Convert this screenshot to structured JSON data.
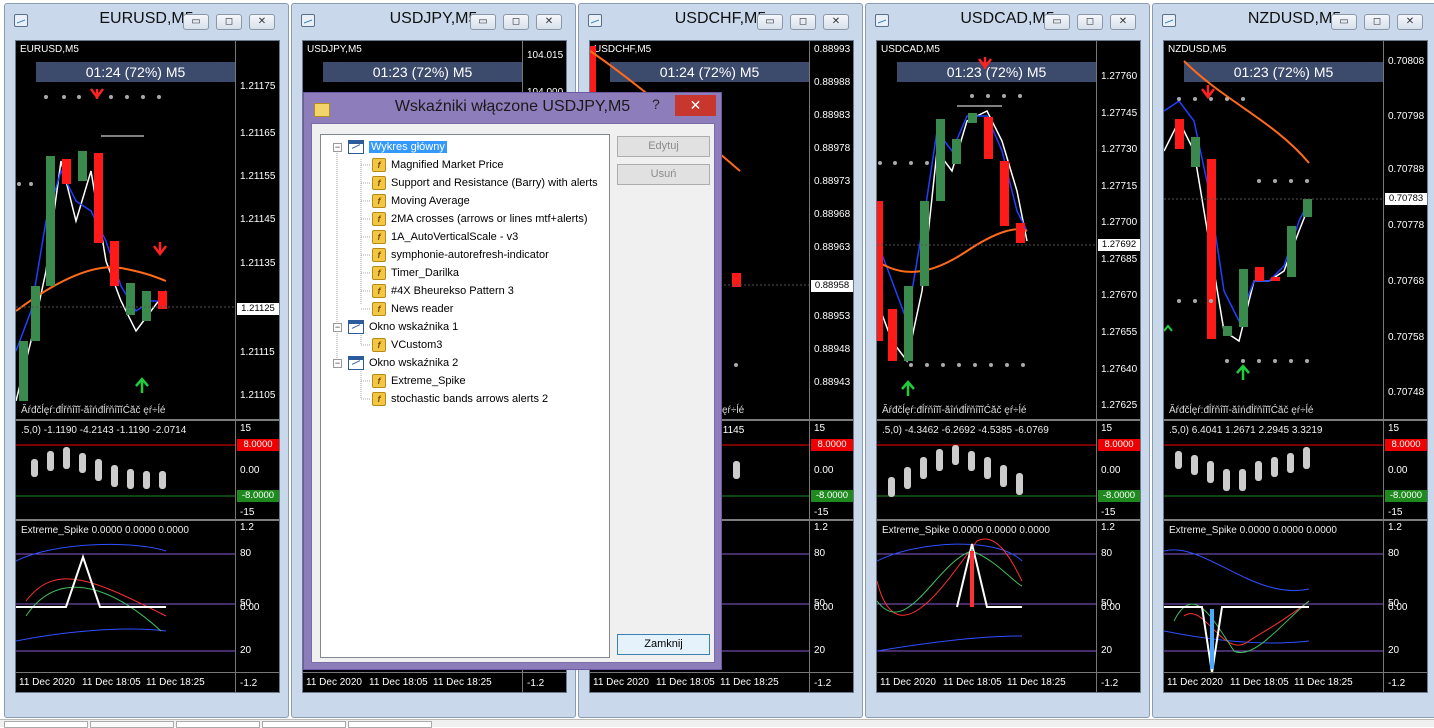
{
  "windows": [
    {
      "id": "eurusd",
      "title": "EURUSD,M5",
      "chart_label": "EURUSD,M5",
      "timer": "01:24 (72%) M5",
      "prices": [
        "1.21175",
        "1.21165",
        "1.21155",
        "1.21145",
        "1.21135",
        "1.21125",
        "1.21115",
        "1.21105"
      ],
      "current_price": "1.21125",
      "gibberish": "Ăŕđčĺęŕ:đĺřňîĭĭ-ăîńđĺřňîĭĭĆăč ęŕ÷ĺé",
      "indicator1_text": ".5,0) -1.1190 -4.2143 -1.1190 -2.0714",
      "indicator1_scale": [
        "15",
        "8.0000",
        "0.00",
        "-8.0000",
        "-15"
      ],
      "indicator2_text": "Extreme_Spike 0.0000 0.0000 0.0000",
      "indicator2_scale": [
        "1.2",
        "80",
        "50",
        "0.00",
        "20",
        "-1.2"
      ],
      "times": [
        "11 Dec 2020",
        "11 Dec 18:05",
        "11 Dec 18:25"
      ]
    },
    {
      "id": "usdjpy",
      "title": "USDJPY,M5",
      "chart_label": "USDJPY,M5",
      "timer": "01:23 (72%) M5",
      "prices": [
        "104.015",
        "104.000"
      ],
      "indicator2_scale": [
        "-1.2"
      ],
      "times": [
        "11 Dec 2020",
        "11 Dec 18:05",
        "11 Dec 18:25"
      ]
    },
    {
      "id": "usdchf",
      "title": "USDCHF,M5",
      "chart_label": "USDCHF,M5",
      "timer": "01:24 (72%) M5",
      "prices": [
        "0.88993",
        "0.88988",
        "0.88983",
        "0.88978",
        "0.88973",
        "0.88968",
        "0.88963",
        "0.88958",
        "0.88953",
        "0.88948",
        "0.88943"
      ],
      "current_price": "0.88958",
      "gibberish": "ęŕ÷ĺé",
      "indicator1_text": ".1145",
      "indicator1_scale": [
        "15",
        "8.0000",
        "0.00",
        "-8.0000",
        "-15"
      ],
      "indicator2_scale": [
        "1.2",
        "80",
        "50",
        "0.00",
        "20",
        "-1.2"
      ],
      "times": [
        "11 Dec 2020",
        "11 Dec 18:05",
        "11 Dec 18:25"
      ]
    },
    {
      "id": "usdcad",
      "title": "USDCAD,M5",
      "chart_label": "USDCAD,M5",
      "timer": "01:23 (72%) M5",
      "prices": [
        "1.27760",
        "1.27745",
        "1.27730",
        "1.27715",
        "1.27700",
        "1.27685",
        "1.27670",
        "1.27655",
        "1.27640",
        "1.27625"
      ],
      "current_price": "1.27692",
      "gibberish": "Ăŕđčĺęŕ:đĺřňîĭĭ-ăîńđĺřňîĭĭĆăč ęŕ÷ĺé",
      "indicator1_text": ".5,0) -4.3462 -6.2692 -4.5385 -6.0769",
      "indicator1_scale": [
        "15",
        "8.0000",
        "0.00",
        "-8.0000",
        "-15"
      ],
      "indicator2_text": "Extreme_Spike 0.0000 0.0000 0.0000",
      "indicator2_scale": [
        "1.2",
        "80",
        "50",
        "0.00",
        "20",
        "-1.2"
      ],
      "times": [
        "11 Dec 2020",
        "11 Dec 18:05",
        "11 Dec 18:25"
      ]
    },
    {
      "id": "nzdusd",
      "title": "NZDUSD,M5",
      "chart_label": "NZDUSD,M5",
      "timer": "01:23 (72%) M5",
      "prices": [
        "0.70808",
        "0.70798",
        "0.70788",
        "0.70778",
        "0.70768",
        "0.70758",
        "0.70748"
      ],
      "current_price": "0.70783",
      "gibberish": "Ăŕđčĺęŕ:đĺřňîĭĭ-ăîńđĺřňîĭĭĆăč ęŕ÷ĺé",
      "indicator1_text": ".5,0) 6.4041 1.2671 2.2945 3.3219",
      "indicator1_scale": [
        "15",
        "8.0000",
        "0.00",
        "-8.0000",
        "-15"
      ],
      "indicator2_text": "Extreme_Spike 0.0000 0.0000 0.0000",
      "indicator2_scale": [
        "1.2",
        "80",
        "50",
        "0.00",
        "20",
        "-1.2"
      ],
      "times": [
        "11 Dec 2020",
        "11 Dec 18:05",
        "11 Dec 18:25"
      ]
    }
  ],
  "window_buttons": {
    "minimize": "▭",
    "restore": "◻",
    "close": "✕"
  },
  "dialog": {
    "title": "Wskaźniki włączone USDJPY,M5",
    "help": "?",
    "close": "✕",
    "tree": {
      "main": "Wykres główny",
      "main_items": [
        "Magnified Market Price",
        "Support and Resistance (Barry) with alerts",
        "Moving Average",
        "2MA crosses (arrows or lines mtf+alerts)",
        "1A_AutoVerticalScale - v3",
        "symphonie-autorefresh-indicator",
        "Timer_Darilka",
        "#4X Bheurekso Pattern 3",
        "News reader"
      ],
      "window1": "Okno wskaźnika 1",
      "window1_items": [
        "VCustom3"
      ],
      "window2": "Okno wskaźnika 2",
      "window2_items": [
        "Extreme_Spike",
        "stochastic bands arrows alerts 2"
      ]
    },
    "buttons": {
      "edit": "Edytuj",
      "delete": "Usuń",
      "close": "Zamknij"
    }
  },
  "colors": {
    "bull": "#3a8a4e",
    "bear": "#ff1a1a",
    "ma": "#ff6a1a",
    "arrow_up": "#1fcc3a",
    "arrow_down": "#ff2222"
  }
}
